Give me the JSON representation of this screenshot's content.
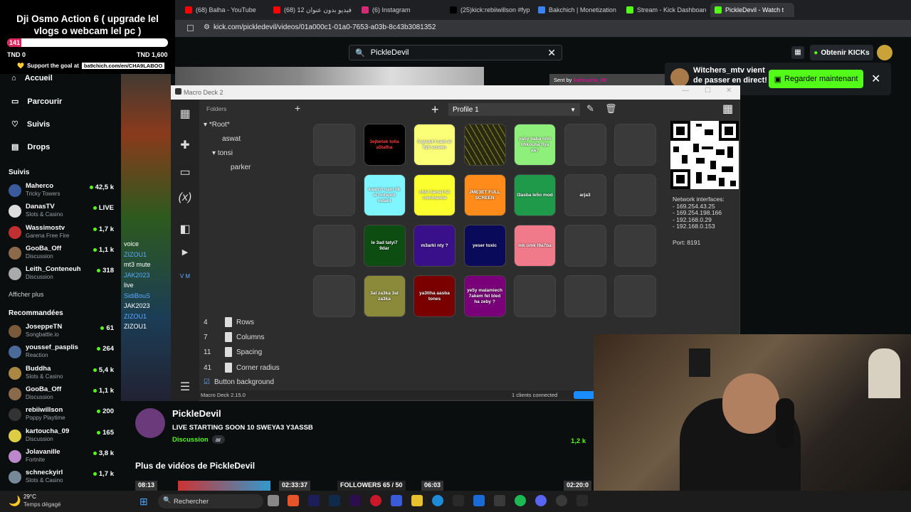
{
  "browser": {
    "tabs": [
      {
        "label": "(68) Balha - YouTube",
        "color": "#ff0000",
        "active": false
      },
      {
        "label": "(68) فيديو بدون عنوان 12",
        "color": "#ff0000",
        "active": false
      },
      {
        "label": "(6) Instagram",
        "color": "#d62976",
        "active": false
      },
      {
        "label": "(25)kick:rebiiwillson #fyp",
        "color": "#000000",
        "active": false
      },
      {
        "label": "Bakchich | Monetization",
        "color": "#3b82f6",
        "active": false
      },
      {
        "label": "Stream - Kick Dashboard",
        "color": "#53fc18",
        "active": false
      },
      {
        "label": "PickleDevil - Watch t",
        "color": "#53fc18",
        "active": true
      }
    ],
    "url": "kick.com/pickledevil/videos/01a000c1-01a0-7653-a03b-8c43b3081352"
  },
  "goal": {
    "title": "Dji Osmo Action 6 ( upgrade lel vlogs o webcam lel pc )",
    "current": "141",
    "progress": 0.09,
    "min": "TND 0",
    "max": "TND 1,600",
    "support_text": "Support the goal at",
    "link": "ba9chich.com/en/CHA9LABOO"
  },
  "search": {
    "value": "PickleDevil"
  },
  "kicks_button": "Obtenir KICKs",
  "nav": [
    {
      "label": "Accueil",
      "icon": "home-icon"
    },
    {
      "label": "Parcourir",
      "icon": "browse-icon"
    },
    {
      "label": "Suivis",
      "icon": "heart-icon"
    },
    {
      "label": "Drops",
      "icon": "drops-icon"
    }
  ],
  "following": {
    "title": "Suivis",
    "channels": [
      {
        "name": "Maherco",
        "sub": "Tricky Towers",
        "viewers": "42,5 k",
        "color": "#3a5a9a"
      },
      {
        "name": "DanasTV",
        "sub": "Slots & Casino",
        "viewers": "LIVE",
        "color": "#ddd"
      },
      {
        "name": "Wassimostv",
        "sub": "Garena Free Fire",
        "viewers": "1,7 k",
        "color": "#c03030"
      },
      {
        "name": "GooBa_Off",
        "sub": "Discussion",
        "viewers": "1,1 k",
        "color": "#8a6a4a"
      },
      {
        "name": "Leith_Conteneuh",
        "sub": "Discussion",
        "viewers": "318",
        "color": "#aaa"
      }
    ],
    "show_more": "Afficher plus"
  },
  "recommended": {
    "title": "Recommandées",
    "channels": [
      {
        "name": "JoseppeTN",
        "sub": "Songbattle.io",
        "viewers": "61",
        "color": "#7a5a3a"
      },
      {
        "name": "youssef_pasplis",
        "sub": "Reaction",
        "viewers": "264",
        "color": "#4a6a9a"
      },
      {
        "name": "Buddha",
        "sub": "Slots & Casino",
        "viewers": "5,4 k",
        "color": "#aa8844"
      },
      {
        "name": "GooBa_Off",
        "sub": "Discussion",
        "viewers": "1,1 k",
        "color": "#8a6a4a"
      },
      {
        "name": "rebiiwillson",
        "sub": "Poppy Playtime",
        "viewers": "200",
        "color": "#333"
      },
      {
        "name": "kartoucha_09",
        "sub": "Discussion",
        "viewers": "165",
        "color": "#ddcc44"
      },
      {
        "name": "Jolavanille",
        "sub": "Fortnite",
        "viewers": "3,8 k",
        "color": "#bb88cc"
      },
      {
        "name": "schneckyirl",
        "sub": "Slots & Casino",
        "viewers": "1,7 k",
        "color": "#778899"
      }
    ]
  },
  "chat_overlay": [
    "voice",
    "ZIZOU1",
    "mt3 mute",
    "JAK2023",
    "live",
    "SidiBouS",
    "JAK2023",
    "ZIZOU1",
    "ZIZOU1"
  ],
  "notification": {
    "text_line1": "Witchers_mtv vient",
    "text_line2": "de passer en direct!",
    "button": "Regarder maintenant"
  },
  "macro_deck": {
    "window_title": "Macro Deck 2",
    "folders_label": "Folders",
    "folders": [
      "*Root*",
      "aswat",
      "tonsi",
      "parker"
    ],
    "profile": "Profile 1",
    "buttons": [
      {
        "row": 0,
        "col": 0,
        "label": "",
        "bg": "#3a3a3a"
      },
      {
        "row": 0,
        "col": 1,
        "label": "3ejbetek tolla a5tafha",
        "bg": "#000000",
        "fg": "#ff3b3b"
      },
      {
        "row": 0,
        "col": 2,
        "label": "5 grout l cam el full screen",
        "bg": "#fbff78",
        "fg": "#ffffff"
      },
      {
        "row": 0,
        "col": 3,
        "label": "",
        "bg": "#2a2a10"
      },
      {
        "row": 0,
        "col": 4,
        "label": "ya5y baba nhb nhkouha fiya aa?",
        "bg": "#8ef07a",
        "fg": "#ffffff"
      },
      {
        "row": 0,
        "col": 5,
        "label": "",
        "bg": "#3a3a3a"
      },
      {
        "row": 0,
        "col": 6,
        "label": "",
        "bg": "#3a3a3a"
      },
      {
        "row": 1,
        "col": 0,
        "label": "",
        "bg": "#3a3a3a"
      },
      {
        "row": 1,
        "col": 1,
        "label": "kaatch nam lik el hotspot mdam",
        "bg": "#7ff6ff",
        "fg": "#ffffff"
      },
      {
        "row": 1,
        "col": 2,
        "label": "chbi 3amel fel commande",
        "bg": "#fbff30",
        "fg": "#ffffff"
      },
      {
        "row": 1,
        "col": 3,
        "label": "JME3ET FULL SCREEN",
        "bg": "#ff8c1a",
        "fg": "#ffffff"
      },
      {
        "row": 1,
        "col": 4,
        "label": "l3asba le5o mod",
        "bg": "#1f9a4a",
        "fg": "#ffffff"
      },
      {
        "row": 1,
        "col": 5,
        "label": "arja3",
        "bg": "#3a3a3a",
        "fg": "#ffffff"
      },
      {
        "row": 1,
        "col": 6,
        "label": "",
        "bg": "#3a3a3a"
      },
      {
        "row": 2,
        "col": 0,
        "label": "",
        "bg": "#3a3a3a"
      },
      {
        "row": 2,
        "col": 1,
        "label": "le 3ad tatyi7 9dar",
        "bg": "#0d4d12",
        "fg": "#ffffff"
      },
      {
        "row": 2,
        "col": 2,
        "label": "m3arki nty ?",
        "bg": "#3a0f8a",
        "fg": "#ffffff"
      },
      {
        "row": 2,
        "col": 3,
        "label": "yeser toxic",
        "bg": "#0a0a5a",
        "fg": "#ffffff"
      },
      {
        "row": 2,
        "col": 4,
        "label": "mk omk l9a7ba",
        "bg": "#f07a8a",
        "fg": "#ffffff"
      },
      {
        "row": 2,
        "col": 5,
        "label": "",
        "bg": "#3a3a3a"
      },
      {
        "row": 2,
        "col": 6,
        "label": "",
        "bg": "#3a3a3a"
      },
      {
        "row": 3,
        "col": 0,
        "label": "",
        "bg": "#3a3a3a"
      },
      {
        "row": 3,
        "col": 1,
        "label": "3al za3ka 3al za3ka",
        "bg": "#8a8a3a",
        "fg": "#ffffff"
      },
      {
        "row": 3,
        "col": 2,
        "label": "ya3tiha aasba tones",
        "bg": "#7a0000",
        "fg": "#ffffff"
      },
      {
        "row": 3,
        "col": 3,
        "label": "ye5y malamiech 7akem fel bled ha zeby ?",
        "bg": "#7a007a",
        "fg": "#ffffff"
      },
      {
        "row": 3,
        "col": 4,
        "label": "",
        "bg": "#3a3a3a"
      },
      {
        "row": 3,
        "col": 5,
        "label": "",
        "bg": "#3a3a3a"
      },
      {
        "row": 3,
        "col": 6,
        "label": "",
        "bg": "#3a3a3a"
      }
    ],
    "network_title": "Network interfaces:",
    "network": [
      "- 169.254.43.25",
      "- 169.254.198.166",
      "- 192.168.0.29",
      "- 192.168.0.153"
    ],
    "port": "Port: 8191",
    "settings": [
      {
        "value": "4",
        "label": "Rows"
      },
      {
        "value": "7",
        "label": "Columns"
      },
      {
        "value": "11",
        "label": "Spacing"
      },
      {
        "value": "41",
        "label": "Corner radius"
      }
    ],
    "button_background_label": "Button background",
    "version": "Macro Deck 2.15.0",
    "clients": "1 clients connected"
  },
  "stream": {
    "name": "PickleDevil",
    "title": "LIVE STARTING SOON 10 SWEYA3 Y3ASSB",
    "category": "Discussion",
    "lang": "ar",
    "viewers": "1,2 k",
    "more_videos": "Plus de vidéos de PickleDevil",
    "thumb_times": [
      "08:13",
      "02:33:37",
      "06:03",
      "02:20:0"
    ],
    "followers": "FOLLOWERS 65 / 50"
  },
  "taskbar": {
    "temp": "29°C",
    "weather": "Temps dégagé",
    "search": "Rechercher"
  },
  "top_overlays": {
    "sent_by": "Sent by",
    "sender": "kartoucha_09"
  }
}
